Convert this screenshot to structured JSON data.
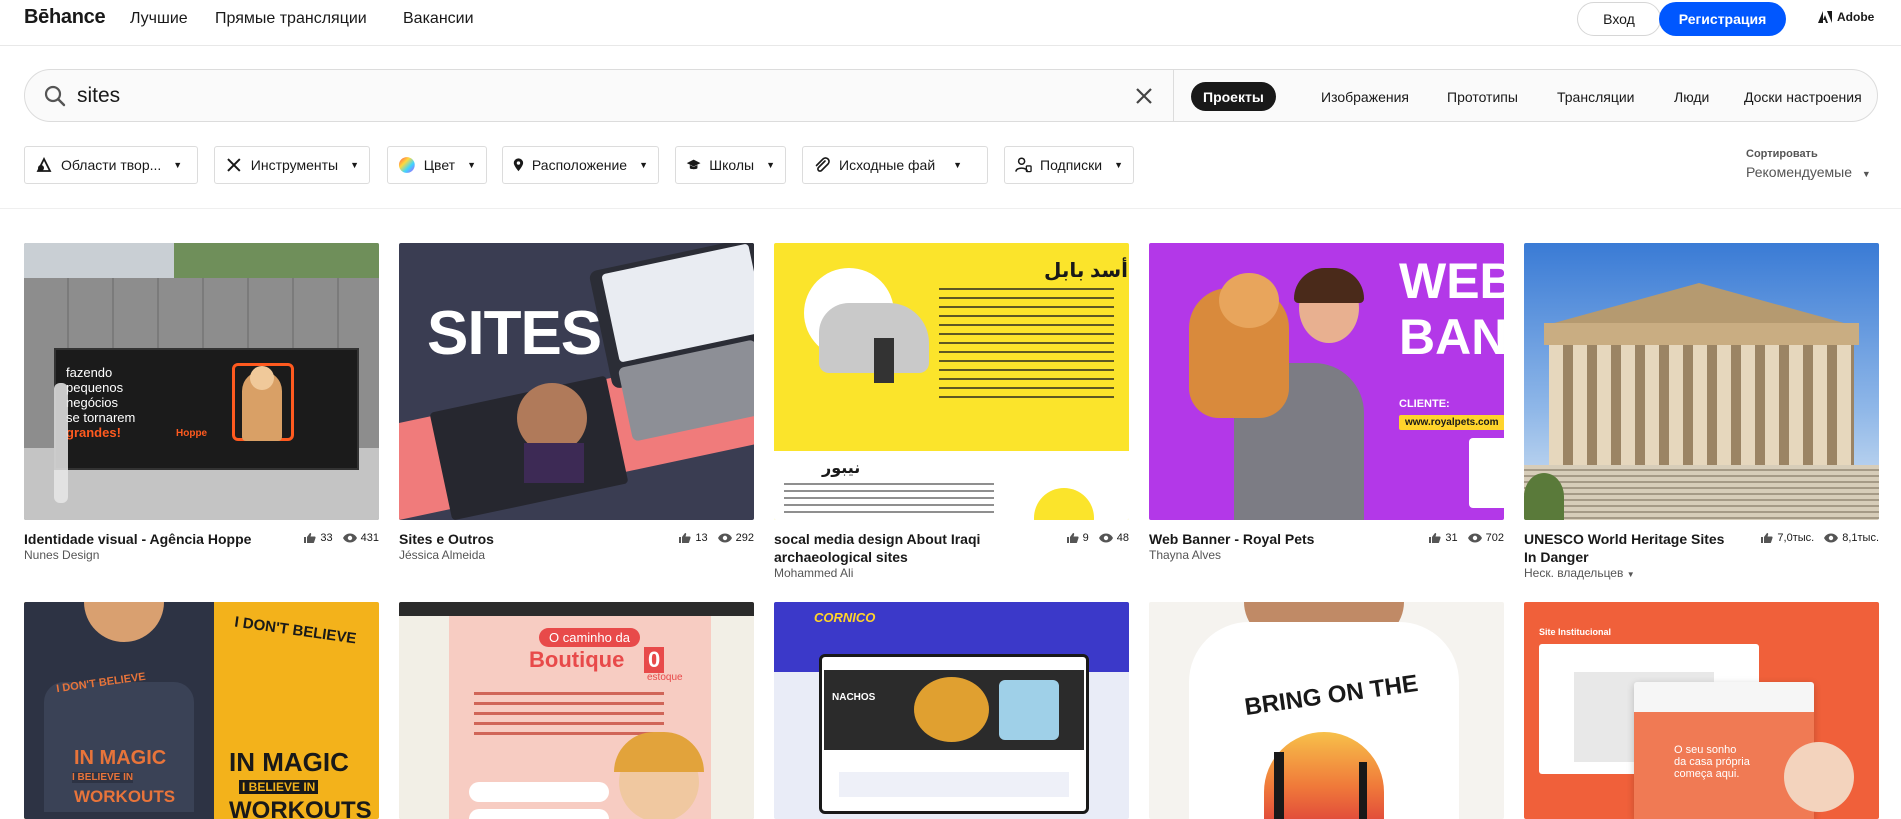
{
  "nav": {
    "logo": "Bēhance",
    "links": [
      "Лучшие",
      "Прямые трансляции",
      "Вакансии"
    ],
    "login": "Вход",
    "signup": "Регистрация",
    "adobe": "Adobe"
  },
  "search": {
    "query": "sites",
    "tabs": [
      "Проекты",
      "Изображения",
      "Прототипы",
      "Трансляции",
      "Люди",
      "Доски настроения"
    ],
    "active_tab": "Проекты"
  },
  "filters": [
    "Области твор...",
    "Инструменты",
    "Цвет",
    "Расположение",
    "Школы",
    "Исходные фай",
    "Подписки"
  ],
  "sort": {
    "label": "Сортировать",
    "value": "Рекомендуемые"
  },
  "projects": [
    {
      "title": "Identidade visual - Agência Hoppe",
      "owner": "Nunes Design",
      "likes": "33",
      "views": "431"
    },
    {
      "title": "Sites e Outros",
      "owner": "Jéssica Almeida",
      "likes": "13",
      "views": "292"
    },
    {
      "title": "socal media design About Iraqi archaeological sites",
      "owner": "Mohammed Ali",
      "likes": "9",
      "views": "48"
    },
    {
      "title": "Web Banner - Royal Pets",
      "owner": "Thayna Alves",
      "likes": "31",
      "views": "702"
    },
    {
      "title": "UNESCO World Heritage Sites In Danger",
      "owner": "Неск. владельцев",
      "likes": "7,0тыс.",
      "views": "8,1тыс."
    }
  ],
  "thumb_text": {
    "hoppe_line1": "fazendo",
    "hoppe_line2": "pequenos",
    "hoppe_line3": "negócios",
    "hoppe_line4": "se tornarem",
    "hoppe_line5": "grandes!",
    "hoppe_brand": "Hoppe",
    "sites": "SITES",
    "arabic_title": "أسد بابل",
    "arabic_title2": "نيبور",
    "web": "WEB",
    "ban": "BAN",
    "client": "CLIENTE:",
    "client_url": "www.royalpets.com",
    "believe": "I DON'T BELIEVE",
    "magic": "IN MAGIC",
    "believe_in": "I BELIEVE IN",
    "workouts": "WORKOUTS",
    "boutique_pre": "O caminho da",
    "boutique": "Boutique",
    "boutique_zero": "0",
    "boutique_stock": "estoque",
    "cornico": "CORNICO",
    "nachos": "NACHOS",
    "bring": "BRING ON THE",
    "site_inst": "Site Institucional",
    "sonho1": "O seu sonho",
    "sonho2": "da casa própria",
    "sonho3": "começa aqui."
  },
  "colors": {
    "accent": "#0057ff",
    "text": "#191919",
    "muted": "#555555",
    "border": "#dcdcdc"
  }
}
